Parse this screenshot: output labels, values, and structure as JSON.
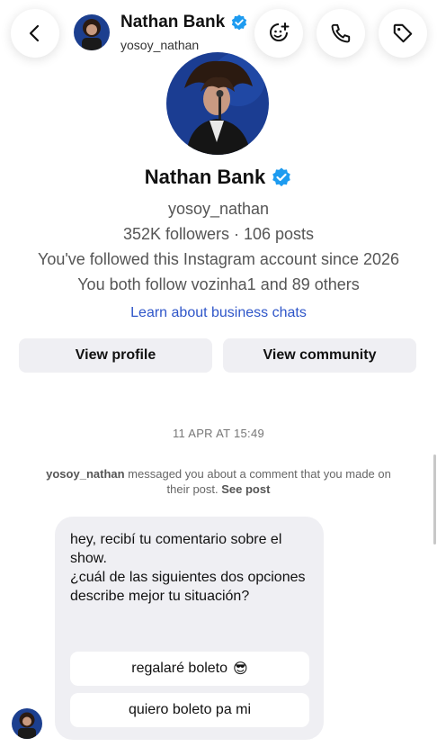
{
  "header": {
    "name": "Nathan Bank",
    "username": "yosoy_nathan",
    "back_icon": "chevron-left-icon",
    "effects_icon": "effects-icon",
    "call_icon": "phone-icon",
    "tag_icon": "tag-icon"
  },
  "profile": {
    "name": "Nathan Bank",
    "username": "yosoy_nathan",
    "stats": "352K followers · 106 posts",
    "followed_since": "You've followed this Instagram account since 2026",
    "mutual": "You both follow vozinha1 and 89 others",
    "learn_link": "Learn about business chats",
    "view_profile": "View profile",
    "view_community": "View community",
    "verified_color": "#1d9bf0"
  },
  "conversation": {
    "timestamp": "11 APR AT 15:49",
    "notice_user": "yosoy_nathan",
    "notice_text": " messaged you about a comment that you made on their post. ",
    "notice_link": "See post",
    "message_lines": [
      "hey, recibí tu comentario sobre el show.",
      "¿cuál de las siguientes dos opciones describe mejor tu situación?"
    ],
    "options": [
      {
        "label": "regalaré boleto",
        "emoji": "😎"
      },
      {
        "label": "quiero boleto pa mi",
        "emoji": ""
      }
    ]
  }
}
